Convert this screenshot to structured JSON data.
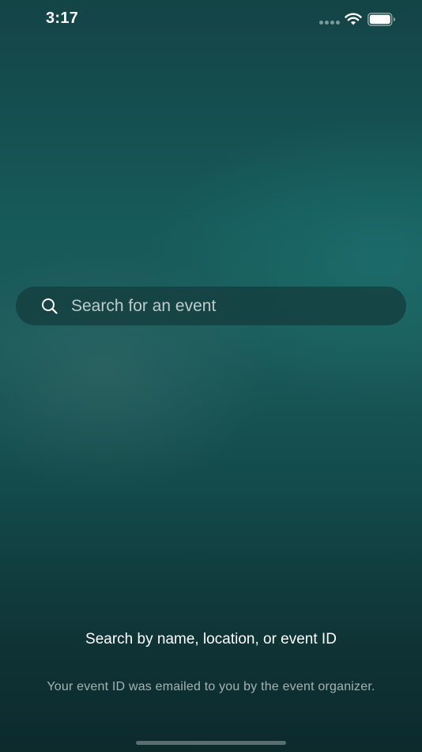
{
  "status_bar": {
    "time": "3:17",
    "icons": [
      "signal-icon",
      "wifi-icon",
      "battery-icon"
    ]
  },
  "search": {
    "placeholder": "Search for an event",
    "value": "",
    "icon": "search-icon"
  },
  "hint": {
    "title": "Search by name, location, or event ID",
    "subtitle": "Your event ID was emailed to you by the event organizer."
  },
  "colors": {
    "background_top": "#134446",
    "background_mid": "#1a5b5a",
    "background_bottom": "#0d2a2d",
    "search_bar_bg": "#143c3e",
    "text_primary": "#ffffff"
  }
}
